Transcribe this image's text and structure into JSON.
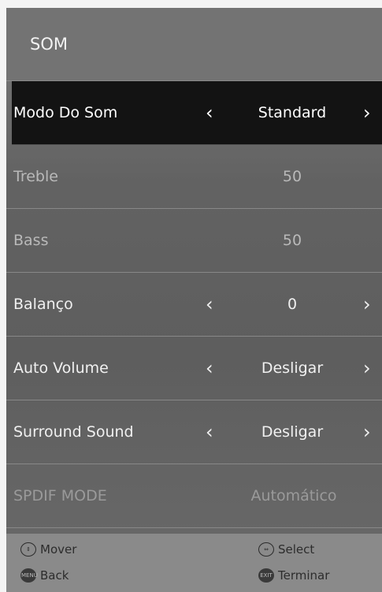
{
  "menu": {
    "title": "SOM",
    "rows": [
      {
        "label": "Modo Do Som",
        "value": "Standard"
      },
      {
        "label": "Treble",
        "value": "50"
      },
      {
        "label": "Bass",
        "value": "50"
      },
      {
        "label": "Balanço",
        "value": "0"
      },
      {
        "label": "Auto Volume",
        "value": "Desligar"
      },
      {
        "label": "Surround Sound",
        "value": "Desligar"
      },
      {
        "label": "SPDIF MODE",
        "value": "Automático"
      }
    ],
    "arrows": {
      "left": "‹",
      "right": "›"
    }
  },
  "footer": {
    "move": "Mover",
    "select": "Select",
    "back": "Back",
    "exit": "Terminar",
    "back_icon_text": "MENU",
    "exit_icon_text": "EXIT"
  }
}
